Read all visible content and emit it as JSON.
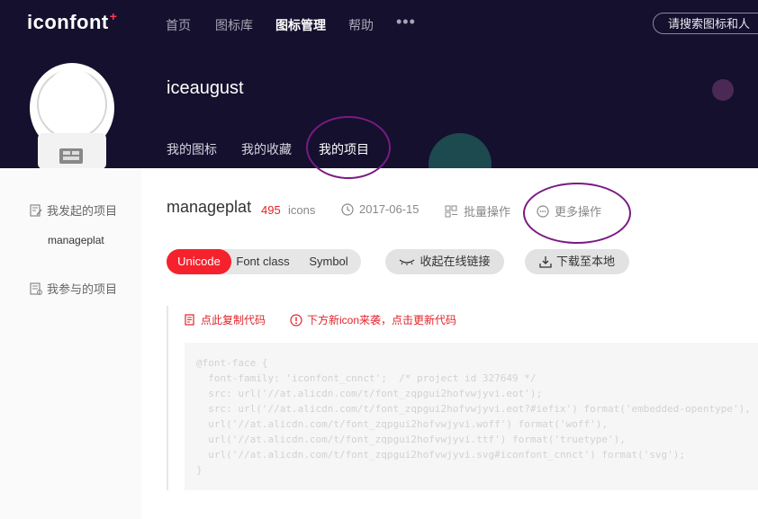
{
  "header": {
    "logo": "iconfont",
    "logo_plus": "+",
    "nav": [
      "首页",
      "图标库",
      "图标管理",
      "帮助"
    ],
    "nav_more": "•••",
    "search_placeholder": "请搜索图标和人"
  },
  "profile": {
    "username": "iceaugust",
    "tabs": [
      "我的图标",
      "我的收藏",
      "我的项目"
    ]
  },
  "sidebar": {
    "initiated": "我发起的项目",
    "initiated_items": [
      "manageplat"
    ],
    "participated": "我参与的项目"
  },
  "project": {
    "name": "manageplat",
    "count": "495",
    "count_unit": "icons",
    "date": "2017-06-15",
    "batch": "批量操作",
    "more": "更多操作"
  },
  "toolbar": {
    "segments": [
      "Unicode",
      "Font class",
      "Symbol"
    ],
    "active_segment": "Unicode",
    "collapse_link": "收起在线链接",
    "download": "下载至本地"
  },
  "notice": {
    "copy": "点此复制代码",
    "update": "下方新icon来袭，点击更新代码"
  },
  "code_lines": [
    "@font-face {",
    "  font-family: 'iconfont_cnnct';  /* project id 327649 */",
    "  src: url('//at.alicdn.com/t/font_zqpgui2hofvwjyvi.eot');",
    "  src: url('//at.alicdn.com/t/font_zqpgui2hofvwjyvi.eot?#iefix') format('embedded-opentype'),",
    "  url('//at.alicdn.com/t/font_zqpgui2hofvwjyvi.woff') format('woff'),",
    "  url('//at.alicdn.com/t/font_zqpgui2hofvwjyvi.ttf') format('truetype'),",
    "  url('//at.alicdn.com/t/font_zqpgui2hofvwjyvi.svg#iconfont_cnnct') format('svg');",
    "}"
  ],
  "colors": {
    "header_bg": "#14102e",
    "accent_red": "#f5222d",
    "annotation": "#7b1a82"
  }
}
